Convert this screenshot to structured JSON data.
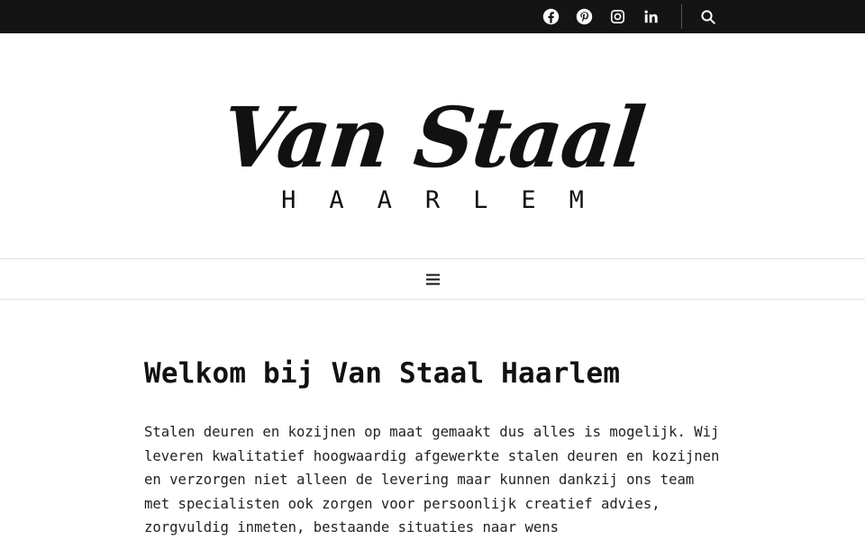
{
  "topbar": {
    "social": [
      {
        "icon": "facebook-icon",
        "label": "Facebook"
      },
      {
        "icon": "pinterest-icon",
        "label": "Pinterest"
      },
      {
        "icon": "instagram-icon",
        "label": "Instagram"
      },
      {
        "icon": "linkedin-icon",
        "label": "LinkedIn"
      }
    ],
    "search_icon": "search-icon",
    "background": "#141414"
  },
  "logo": {
    "main": "Van Staal",
    "sub": "HAARLEM"
  },
  "nav": {
    "menu_icon": "hamburger-icon"
  },
  "main": {
    "title": "Welkom bij Van Staal Haarlem",
    "intro": "Stalen deuren en kozijnen op maat gemaakt dus alles is mogelijk. Wij leveren kwalitatief hoogwaardig afgewerkte stalen deuren en kozijnen en verzorgen niet alleen de levering maar kunnen dankzij ons team met specialisten ook zorgen voor persoonlijk creatief advies, zorgvuldig inmeten, bestaande situaties naar wens"
  }
}
